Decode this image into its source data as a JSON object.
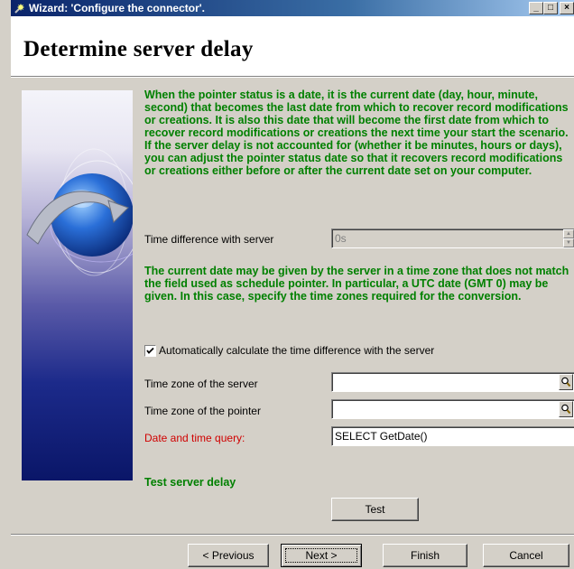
{
  "window": {
    "title": "Wizard: 'Configure the connector'.",
    "controls": {
      "minimize": "_",
      "maximize": "□",
      "close": "×"
    }
  },
  "header": {
    "title": "Determine server delay"
  },
  "intro_text": "When the pointer status is a date, it is the current date (day, hour, minute, second) that becomes the last date from which to recover record modifications or creations. It is also this date that will become the first date from which to recover record modifications or creations the next time your start the scenario. If the server delay is not accounted for (whether it be minutes, hours or days), you can adjust the pointer status date so that it recovers record modifications or creations either before or after the current date set on your computer.",
  "time_difference": {
    "label": "Time difference with server",
    "value": "0s",
    "disabled": true
  },
  "timezone_text": "The current date may be given by the server in a time zone that does not match the field used as schedule pointer. In particular, a UTC date (GMT 0) may be given. In this case, specify the time zones required for the conversion.",
  "auto_calc": {
    "label": "Automatically calculate the time difference with the server",
    "checked": true
  },
  "server_timezone": {
    "label": "Time zone of the server",
    "value": ""
  },
  "pointer_timezone": {
    "label": "Time zone of the pointer",
    "value": ""
  },
  "date_query": {
    "label": "Date and time query:",
    "value": "SELECT GetDate()"
  },
  "test_section": {
    "title": "Test server delay",
    "button": "Test"
  },
  "nav": {
    "previous": "< Previous",
    "next": "Next >",
    "finish": "Finish",
    "cancel": "Cancel"
  },
  "icons": {
    "lookup": "magnifier-icon",
    "spin": "spin-arrows-icon",
    "window": "wizard-icon"
  },
  "colors": {
    "heading_green": "#008000",
    "label_red": "#d00000",
    "titlebar": "#0a246a"
  }
}
